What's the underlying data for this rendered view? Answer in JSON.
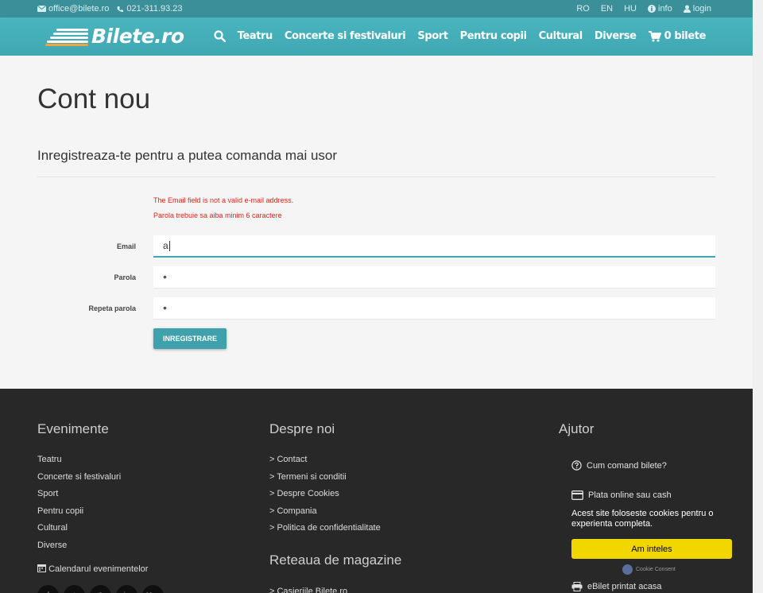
{
  "topbar": {
    "email": "office@bilete.ro",
    "phone": "021-311.93.23",
    "languages": [
      "RO",
      "EN",
      "HU"
    ],
    "info_label": "info",
    "login_label": "login"
  },
  "nav": {
    "logo_text": "Bilete.ro",
    "items": [
      "Teatru",
      "Concerte si festivaluri",
      "Sport",
      "Pentru copii",
      "Cultural",
      "Diverse"
    ],
    "cart_label": "0 bilete"
  },
  "page": {
    "title": "Cont nou",
    "subtitle": "Inregistreaza-te pentru a putea comanda mai usor",
    "errors": [
      "The Email field is not a valid e-mail address.",
      "Parola trebuie sa aiba minim 6 caractere"
    ]
  },
  "form": {
    "email_label": "Email",
    "email_value": "a",
    "password_label": "Parola",
    "password_value": "•",
    "repeat_label": "Repeta parola",
    "repeat_value": "•",
    "submit_label": "INREGISTRARE"
  },
  "footer": {
    "events_title": "Evenimente",
    "events": [
      "Teatru",
      "Concerte si festivaluri",
      "Sport",
      "Pentru copii",
      "Cultural",
      "Diverse"
    ],
    "calendar_label": "Calendarul evenimentelor",
    "about_title": "Despre noi",
    "about": [
      "> Contact",
      "> Termeni si conditii",
      "> Despre Cookies",
      "> Compania",
      "> Politica de confidentialitate"
    ],
    "stores_title": "Reteaua de magazine",
    "stores": [
      "> Casieriile Bilete.ro"
    ],
    "help_title": "Ajutor",
    "help": [
      "Cum comand bilete?",
      "Plata online sau cash",
      "eBilet printat acasa"
    ],
    "social": [
      "f",
      "t",
      "◎",
      "in",
      "You"
    ]
  },
  "cookie": {
    "text": "Acest site foloseste cookies pentru o experienta completa.",
    "button": "Am inteles",
    "brand": "Cookie Consent"
  },
  "colors": {
    "accent": "#3fa7b2",
    "error": "#e2231a",
    "footer": "#282828",
    "cookie_button": "#f1d600"
  }
}
